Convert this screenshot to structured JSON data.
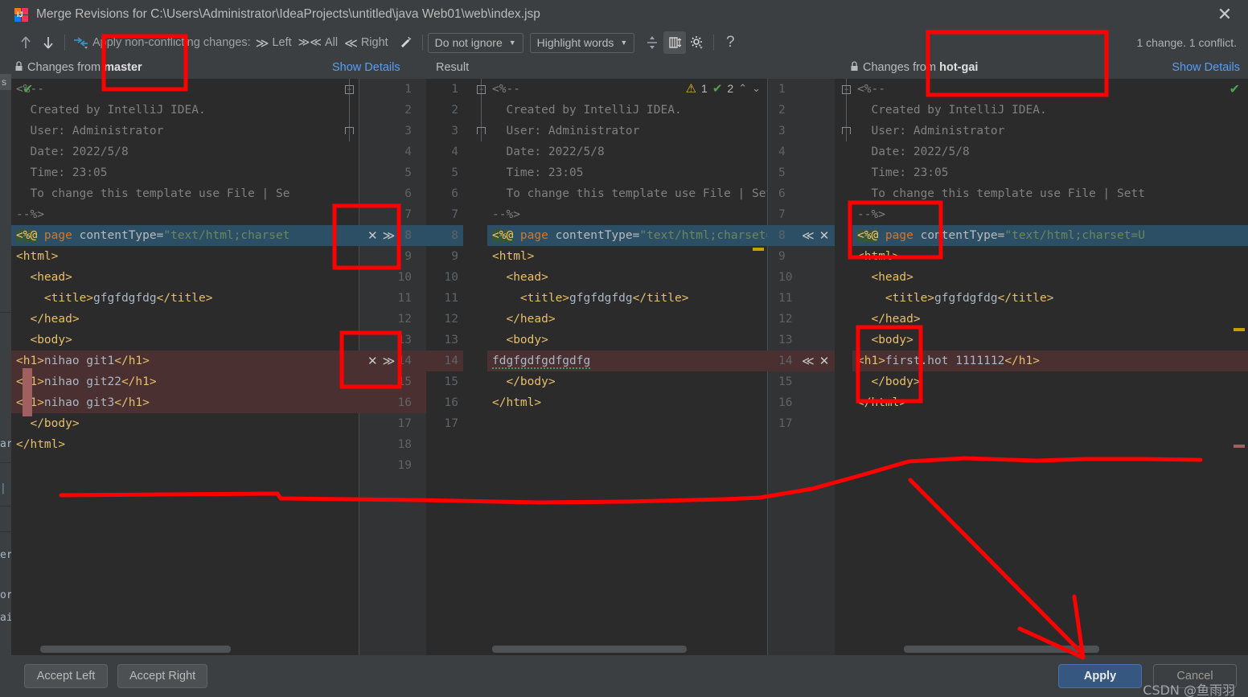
{
  "window": {
    "title": "Merge Revisions for C:\\Users\\Administrator\\IdeaProjects\\untitled\\java Web01\\web\\index.jsp",
    "close_label": "✕",
    "app_icon_text": "IJ"
  },
  "toolbar": {
    "prev_diff_icon": "↑",
    "next_diff_icon": "↓",
    "apply_all_icon": "⇥",
    "apply_label": "Apply non-conflicting changes:",
    "left_glyph": "≫",
    "left_label": "Left",
    "all_glyph": "≫≪",
    "all_label": "All",
    "right_glyph": "≪",
    "right_label": "Right",
    "magic_icon": "✨",
    "ignore_select": "Do not ignore",
    "highlight_select": "Highlight words",
    "collapse_icon": "⇵",
    "columns_icon": "‖",
    "settings_icon": "⚙",
    "help_icon": "?",
    "caret": "▼",
    "status": "1 change. 1 conflict."
  },
  "headers": {
    "lock_icon": "🔒",
    "left_prefix": "Changes from ",
    "left_branch": "master",
    "left_show_details": "Show Details",
    "result_label": "Result",
    "right_prefix": "Changes from ",
    "right_branch": "hot-gai",
    "right_show_details": "Show Details"
  },
  "result_badges": {
    "warning_icon": "⚠",
    "warning_count": "1",
    "ok_icon": "✔",
    "ok_count": "2",
    "up_icon": "⌃",
    "down_icon": "⌄"
  },
  "left_pane": {
    "ok_icon": "✔",
    "lines": [
      {
        "num": 1,
        "text": "<%--",
        "cls": "cmt"
      },
      {
        "num": 2,
        "text": "  Created by IntelliJ IDEA.",
        "cls": "cmt"
      },
      {
        "num": 3,
        "text": "  User: Administrator",
        "cls": "cmt"
      },
      {
        "num": 4,
        "text": "  Date: 2022/5/8",
        "cls": "cmt"
      },
      {
        "num": 5,
        "text": "  Time: 23:05",
        "cls": "cmt"
      },
      {
        "num": 6,
        "text": "  To change this template use File | Se",
        "cls": "cmt"
      },
      {
        "num": 7,
        "text": "--%>",
        "cls": "cmt"
      },
      {
        "num": 8,
        "text": "<%@ page contentType=\"text/html;charset",
        "cls": "jsp",
        "state": "selected",
        "actions": [
          "✕",
          "≫"
        ]
      },
      {
        "num": 9,
        "text": "<html>",
        "cls": "tag"
      },
      {
        "num": 10,
        "text": "  <head>",
        "cls": "tag"
      },
      {
        "num": 11,
        "text": "    <title>gfgfdgfdg</title>",
        "cls": "tag"
      },
      {
        "num": 12,
        "text": "  </head>",
        "cls": "tag"
      },
      {
        "num": 13,
        "text": "  <body>",
        "cls": "tag"
      },
      {
        "num": 14,
        "text": "<h1>nihao git1</h1>",
        "cls": "tag",
        "state": "conflict",
        "actions": [
          "✕",
          "≫"
        ]
      },
      {
        "num": 15,
        "text": "<h1>nihao git22</h1>",
        "cls": "tag",
        "state": "conflict"
      },
      {
        "num": 16,
        "text": "<h1>nihao git3</h1>",
        "cls": "tag",
        "state": "conflict"
      },
      {
        "num": 17,
        "text": "  </body>",
        "cls": "tag"
      },
      {
        "num": 18,
        "text": "</html>",
        "cls": "tag"
      },
      {
        "num": 19,
        "text": "",
        "cls": "tag"
      }
    ]
  },
  "result_pane": {
    "lines": [
      {
        "num": 1,
        "text": "<%--",
        "cls": "cmt"
      },
      {
        "num": 2,
        "text": "  Created by IntelliJ IDEA.",
        "cls": "cmt"
      },
      {
        "num": 3,
        "text": "  User: Administrator",
        "cls": "cmt"
      },
      {
        "num": 4,
        "text": "  Date: 2022/5/8",
        "cls": "cmt"
      },
      {
        "num": 5,
        "text": "  Time: 23:05",
        "cls": "cmt"
      },
      {
        "num": 6,
        "text": "  To change this template use File | Settin",
        "cls": "cmt"
      },
      {
        "num": 7,
        "text": "--%>",
        "cls": "cmt"
      },
      {
        "num": 8,
        "text": "<%@ page contentType=\"text/html;charset=UTF",
        "cls": "jsp",
        "state": "selected"
      },
      {
        "num": 9,
        "text": "<html>",
        "cls": "tag"
      },
      {
        "num": 10,
        "text": "  <head>",
        "cls": "tag"
      },
      {
        "num": 11,
        "text": "    <title>gfgfdgfdg</title>",
        "cls": "tag"
      },
      {
        "num": 12,
        "text": "  </head>",
        "cls": "tag"
      },
      {
        "num": 13,
        "text": "  <body>",
        "cls": "tag"
      },
      {
        "num": 14,
        "text": "  fdgfgdfgdfgdfg",
        "cls": "txt",
        "state": "conflict"
      },
      {
        "num": 15,
        "text": "  </body>",
        "cls": "tag"
      },
      {
        "num": 16,
        "text": "</html>",
        "cls": "tag"
      },
      {
        "num": 17,
        "text": "",
        "cls": "tag"
      }
    ]
  },
  "right_pane": {
    "ok_icon": "✔",
    "lines": [
      {
        "num": 1,
        "text": "<%--",
        "cls": "cmt"
      },
      {
        "num": 2,
        "text": "  Created by IntelliJ IDEA.",
        "cls": "cmt"
      },
      {
        "num": 3,
        "text": "  User: Administrator",
        "cls": "cmt"
      },
      {
        "num": 4,
        "text": "  Date: 2022/5/8",
        "cls": "cmt"
      },
      {
        "num": 5,
        "text": "  Time: 23:05",
        "cls": "cmt"
      },
      {
        "num": 6,
        "text": "  To change this template use File | Sett",
        "cls": "cmt"
      },
      {
        "num": 7,
        "text": "--%>",
        "cls": "cmt"
      },
      {
        "num": 8,
        "text": "<%@ page contentType=\"text/html;charset=U",
        "cls": "jsp",
        "state": "selected",
        "actions": [
          "≪",
          "✕"
        ]
      },
      {
        "num": 9,
        "text": "<html>",
        "cls": "tag"
      },
      {
        "num": 10,
        "text": "  <head>",
        "cls": "tag"
      },
      {
        "num": 11,
        "text": "    <title>gfgfdgfdg</title>",
        "cls": "tag"
      },
      {
        "num": 12,
        "text": "  </head>",
        "cls": "tag"
      },
      {
        "num": 13,
        "text": "  <body>",
        "cls": "tag"
      },
      {
        "num": 14,
        "text": "<h1>first.hot 1111112</h1>",
        "cls": "tag",
        "state": "conflict",
        "actions": [
          "≪",
          "✕"
        ]
      },
      {
        "num": 15,
        "text": "  </body>",
        "cls": "tag"
      },
      {
        "num": 16,
        "text": "</html>",
        "cls": "tag"
      },
      {
        "num": 17,
        "text": "",
        "cls": "tag"
      }
    ]
  },
  "buttons": {
    "accept_left": "Accept Left",
    "accept_right": "Accept Right",
    "apply": "Apply",
    "cancel": "Cancel"
  },
  "watermark": "CSDN @鱼雨羽",
  "background_window": {
    "tab_label": "s",
    "fragments": [
      "ar",
      "er",
      "or",
      "ai"
    ]
  },
  "colors": {
    "accent_blue": "#589df6",
    "selection": "#2d4f66",
    "conflict": "#4a3030",
    "annotation_red": "#ff0000",
    "primary_button": "#365880"
  }
}
